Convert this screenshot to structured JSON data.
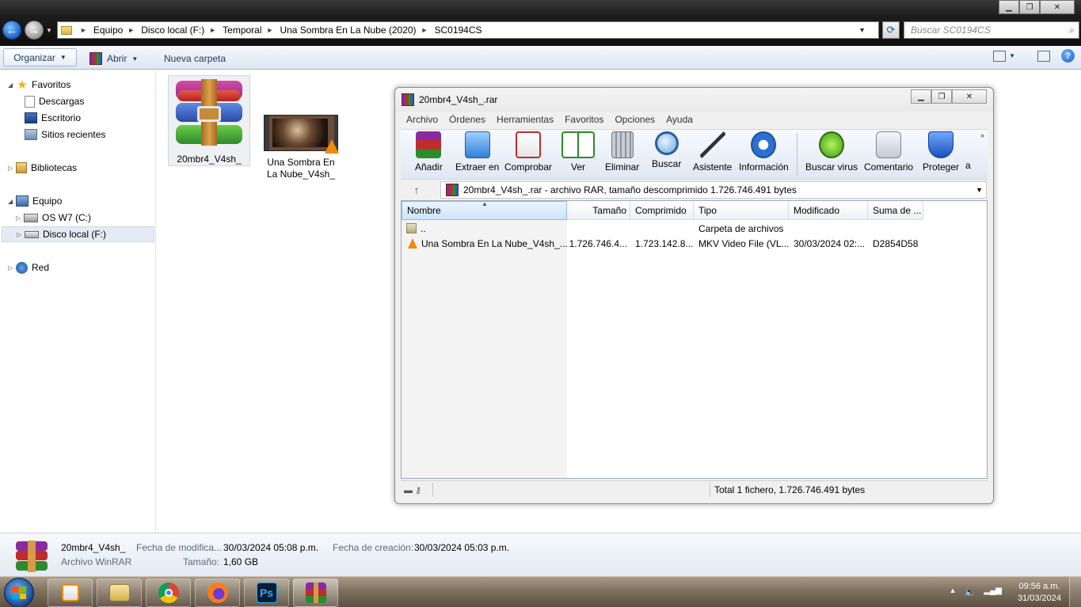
{
  "explorer": {
    "address": {
      "crumbs": [
        "Equipo",
        "Disco local (F:)",
        "Temporal",
        "Una Sombra En La Nube (2020)",
        "SC0194CS"
      ]
    },
    "search_placeholder": "Buscar SC0194CS",
    "toolbar": {
      "organize": "Organizar",
      "open": "Abrir",
      "new_folder": "Nueva carpeta"
    },
    "nav": {
      "favorites": "Favoritos",
      "downloads": "Descargas",
      "desktop": "Escritorio",
      "recent": "Sitios recientes",
      "libraries": "Bibliotecas",
      "computer": "Equipo",
      "drive_c": "OS W7 (C:)",
      "drive_f": "Disco local (F:)",
      "network": "Red"
    },
    "files": [
      {
        "name": "20mbr4_V4sh_",
        "icon": "winrar-archive-icon"
      },
      {
        "name_line1": "Una Sombra En",
        "name_line2": "La Nube_V4sh_",
        "icon": "video-thumbnail-icon"
      }
    ],
    "details": {
      "name": "20mbr4_V4sh_",
      "type": "Archivo WinRAR",
      "modified_label": "Fecha de modifica...",
      "modified": "30/03/2024 05:08 p.m.",
      "created_label": "Fecha de creación:",
      "created": "30/03/2024 05:03 p.m.",
      "size_label": "Tamaño:",
      "size": "1,60 GB"
    }
  },
  "winrar": {
    "title": "20mbr4_V4sh_.rar",
    "menu": [
      "Archivo",
      "Órdenes",
      "Herramientas",
      "Favoritos",
      "Opciones",
      "Ayuda"
    ],
    "tools": [
      "Añadir",
      "Extraer en",
      "Comprobar",
      "Ver",
      "Eliminar",
      "Buscar",
      "Asistente",
      "Información",
      "Buscar virus",
      "Comentario",
      "Proteger",
      "a"
    ],
    "path": "20mbr4_V4sh_.rar - archivo RAR, tamaño descomprimido 1.726.746.491 bytes",
    "columns": [
      "Nombre",
      "Tamaño",
      "Comprimido",
      "Tipo",
      "Modificado",
      "Suma de ..."
    ],
    "rows": [
      {
        "name": "..",
        "size": "",
        "packed": "",
        "type": "Carpeta de archivos",
        "modified": "",
        "crc": ""
      },
      {
        "name": "Una Sombra En La Nube_V4sh_....",
        "size": "1.726.746.4...",
        "packed": "1.723.142.8...",
        "type": "MKV Video File (VL...",
        "modified": "30/03/2024 02:...",
        "crc": "D2854D58"
      }
    ],
    "status": "Total 1 fichero, 1.726.746.491 bytes"
  },
  "taskbar": {
    "time": "09:56 a.m.",
    "date": "31/03/2024",
    "apps": [
      "vlc-icon",
      "explorer-icon",
      "chrome-icon",
      "firefox-icon",
      "photoshop-icon",
      "winrar-icon"
    ],
    "ps_label": "Ps"
  }
}
